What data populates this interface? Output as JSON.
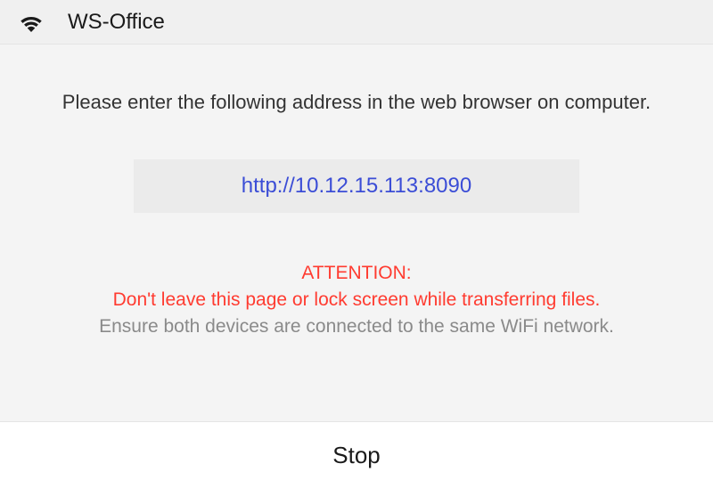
{
  "statusBar": {
    "title": "WS-Office"
  },
  "content": {
    "instruction": "Please enter the following address in the web browser on computer.",
    "url": "http://10.12.15.113:8090",
    "attentionLabel": "ATTENTION:",
    "attentionWarning": "Don't leave this page or lock screen while transferring files.",
    "attentionNote": "Ensure both devices are connected to the same WiFi network."
  },
  "footer": {
    "stopLabel": "Stop"
  }
}
